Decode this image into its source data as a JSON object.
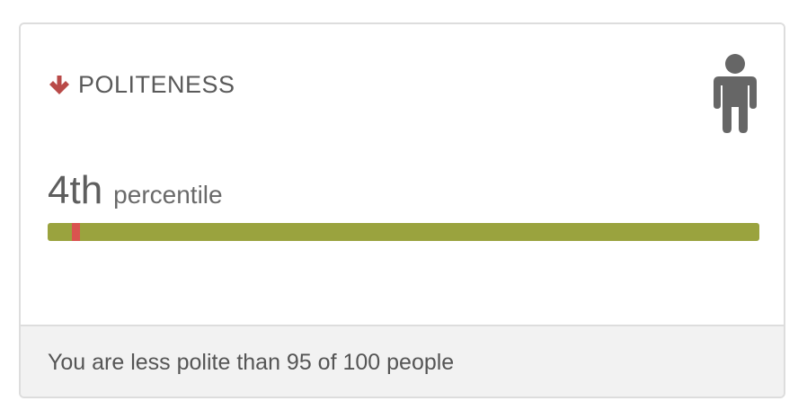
{
  "trait": {
    "direction_icon": "arrow-down-icon",
    "title": "POLITENESS",
    "person_icon": "person-icon"
  },
  "percentile": {
    "value": "4th",
    "label": "percentile",
    "fraction": 0.04
  },
  "footer": {
    "text": "You are less polite than 95 of 100 people"
  },
  "colors": {
    "arrow": "#b94a48",
    "bar": "#9aa33e",
    "marker": "#d9534f",
    "icon": "#666666"
  }
}
